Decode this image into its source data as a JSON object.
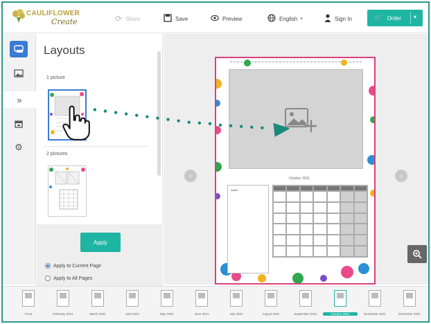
{
  "brand": {
    "name": "CAULIFLOWER",
    "sub": "Create"
  },
  "toolbar": {
    "share_label": "Share",
    "save_label": "Save",
    "preview_label": "Preview",
    "language_label": "English",
    "signin_label": "Sign In",
    "order_label": "Order"
  },
  "panel": {
    "title": "Layouts",
    "section1": "1 picture",
    "section2": "2 pictures",
    "apply_label": "Apply",
    "apply_current": "Apply to Current Page",
    "apply_all": "Apply to All Pages",
    "selected_option": "Apply to Current Page"
  },
  "page": {
    "month_title": "October 2021",
    "notes_label": "Notes"
  },
  "filmstrip": [
    {
      "label": "Front"
    },
    {
      "label": "February 2021"
    },
    {
      "label": "March 2021"
    },
    {
      "label": "April 2021"
    },
    {
      "label": "May 2021"
    },
    {
      "label": "June 2021"
    },
    {
      "label": "July 2021"
    },
    {
      "label": "August 2021"
    },
    {
      "label": "September 2021"
    },
    {
      "label": "October 2021",
      "active": true
    },
    {
      "label": "November 2021"
    },
    {
      "label": "December 2021"
    }
  ],
  "colors": {
    "accent": "#1eb5a3",
    "rail_active": "#3a7bd5",
    "page_border": "#d9417a",
    "drag_arrow": "#1a8a7a"
  },
  "icons": {
    "share": "share-icon",
    "save": "save-icon",
    "preview": "eye-icon",
    "language": "globe-icon",
    "signin": "user-icon",
    "cart": "cart-icon",
    "rail": [
      "layout-icon",
      "image-icon",
      "expand-icon",
      "calendar-icon",
      "gear-icon"
    ],
    "zoom": "zoom-icon"
  }
}
